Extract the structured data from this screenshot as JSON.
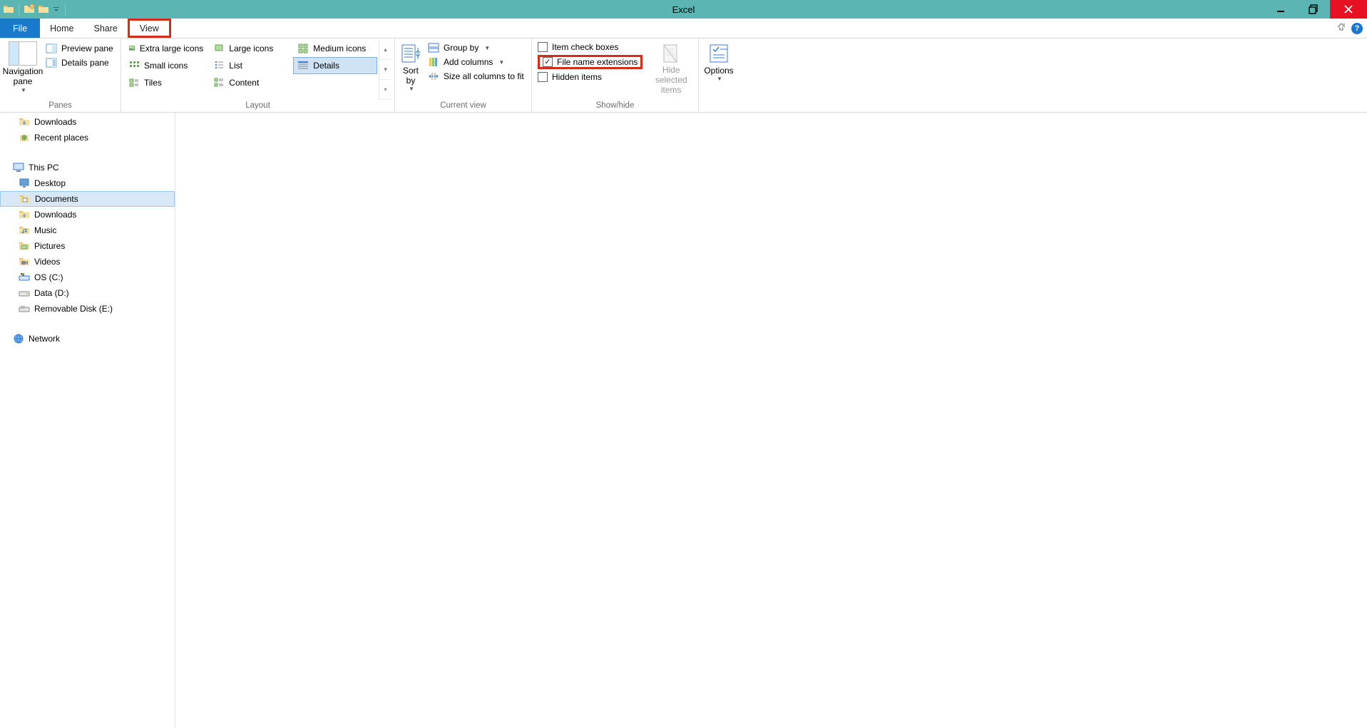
{
  "title": "Excel",
  "tabs": {
    "file": "File",
    "home": "Home",
    "share": "Share",
    "view": "View"
  },
  "ribbon": {
    "panes": {
      "nav_label": "Navigation\npane",
      "preview": "Preview pane",
      "details": "Details pane",
      "group_label": "Panes"
    },
    "layout": {
      "extra_large": "Extra large icons",
      "large": "Large icons",
      "medium": "Medium icons",
      "small": "Small icons",
      "list": "List",
      "details": "Details",
      "tiles": "Tiles",
      "content": "Content",
      "group_label": "Layout"
    },
    "current_view": {
      "sort_label": "Sort\nby",
      "group_by": "Group by",
      "add_columns": "Add columns",
      "size_all": "Size all columns to fit",
      "group_label": "Current view"
    },
    "show_hide": {
      "item_check": "Item check boxes",
      "file_ext": "File name extensions",
      "hidden": "Hidden items",
      "hide_sel": "Hide selected\nitems",
      "group_label": "Show/hide",
      "file_ext_checked": true
    },
    "options": {
      "label": "Options"
    }
  },
  "tree": {
    "favorites": {
      "downloads": "Downloads",
      "recent": "Recent places"
    },
    "this_pc": "This PC",
    "pc_children": {
      "desktop": "Desktop",
      "documents": "Documents",
      "downloads": "Downloads",
      "music": "Music",
      "pictures": "Pictures",
      "videos": "Videos",
      "c": "OS (C:)",
      "d": "Data (D:)",
      "e": "Removable Disk (E:)"
    },
    "network": "Network"
  }
}
